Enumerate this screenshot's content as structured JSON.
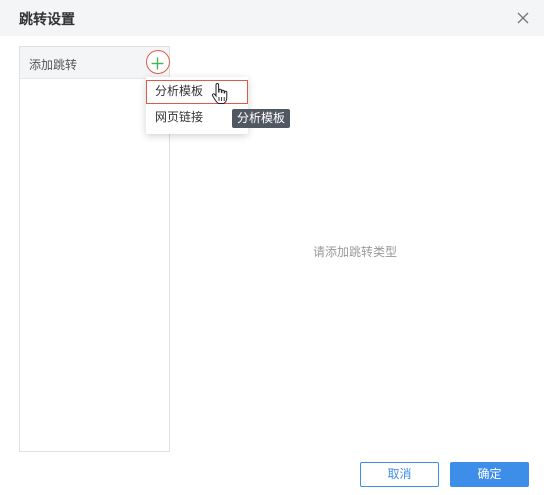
{
  "dialog": {
    "title": "跳转设置",
    "close_icon": "close-icon"
  },
  "left_panel": {
    "title": "添加跳转",
    "add_icon": "plus-circle-icon"
  },
  "menu": {
    "items": [
      {
        "label": "分析模板",
        "active": true
      },
      {
        "label": "网页链接",
        "active": false
      }
    ]
  },
  "tooltip": {
    "text": "分析模板"
  },
  "main": {
    "empty_hint": "请添加跳转类型"
  },
  "footer": {
    "cancel_label": "取消",
    "ok_label": "确定"
  },
  "colors": {
    "accent": "#3d8ee9",
    "highlight": "#e05a4a",
    "add_green": "#4caf50"
  }
}
